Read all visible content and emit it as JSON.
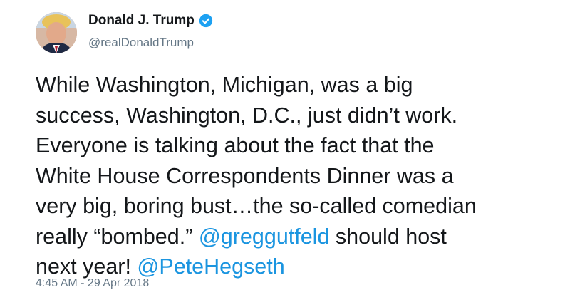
{
  "author": {
    "name": "Donald J. Trump",
    "handle": "@realDonaldTrump",
    "verified_icon": "verified-badge-icon"
  },
  "tweet": {
    "lines": [
      "While Washington, Michigan, was a big",
      "success, Washington, D.C., just didn’t work.",
      "Everyone is talking about the fact that the",
      "White House Correspondents Dinner was a",
      "very big, boring bust…the so-called comedian"
    ],
    "line6_prefix": "really “bombed.” ",
    "mention_1": "@greggutfeld",
    "line6_suffix": " should host",
    "line7_prefix": "next year! ",
    "mention_2": "@PeteHegseth"
  },
  "timestamp": "4:45 AM - 29 Apr 2018",
  "colors": {
    "mention": "#1b95e0",
    "verified": "#1da1f2",
    "secondary_text": "#657786"
  }
}
